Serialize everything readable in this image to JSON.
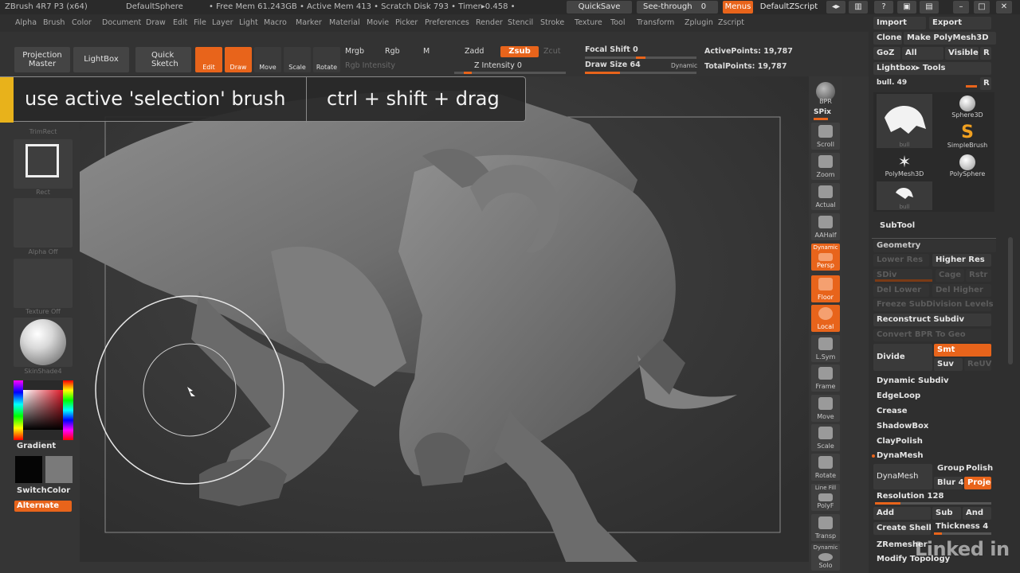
{
  "titlebar": {
    "title": "ZBrush 4R7 P3 (x64)",
    "document": "DefaultSphere",
    "status": "• Free Mem 61.243GB • Active Mem 413 • Scratch Disk 793 • Timer▸0.458 •",
    "quicksave": "QuickSave",
    "seethrough": "See-through",
    "seethrough_value": "0",
    "menus": "Menus",
    "script": "DefaultZScript"
  },
  "menubar": [
    "Alpha",
    "Brush",
    "Color",
    "Document",
    "Draw",
    "Edit",
    "File",
    "Layer",
    "Light",
    "Macro",
    "Marker",
    "Material",
    "Movie",
    "Picker",
    "Preferences",
    "Render",
    "Stencil",
    "Stroke",
    "Texture",
    "Tool",
    "Transform",
    "Zplugin",
    "Zscript"
  ],
  "topshelf": {
    "projection_master": "Projection Master",
    "lightbox": "LightBox",
    "quick_sketch": "Quick Sketch",
    "edit": "Edit",
    "draw": "Draw",
    "move": "Move",
    "scale": "Scale",
    "rotate": "Rotate",
    "mrgb": "Mrgb",
    "rgb": "Rgb",
    "m": "M",
    "rgb_intensity": "Rgb Intensity",
    "zadd": "Zadd",
    "zsub": "Zsub",
    "zcut": "Zcut",
    "z_intensity": "Z Intensity",
    "z_intensity_value": "0",
    "focal_shift": "Focal Shift",
    "focal_shift_value": "0",
    "draw_size": "Draw Size",
    "draw_size_value": "64",
    "dynamic": "Dynamic",
    "active_points": "ActivePoints: 19,787",
    "total_points": "TotalPoints: 19,787"
  },
  "overlay": {
    "instruction": "use active 'selection' brush",
    "shortcut": "ctrl + shift + drag"
  },
  "leftpanel": {
    "trimrect": "TrimRect",
    "rect": "Rect",
    "alpha_off": "Alpha Off",
    "texture_off": "Texture Off",
    "skinshade": "SkinShade4",
    "gradient": "Gradient",
    "switchcolor": "SwitchColor",
    "alternate": "Alternate"
  },
  "rightshelf": {
    "bpr": "BPR",
    "spix": "SPix",
    "spix_value": "3",
    "scroll": "Scroll",
    "zoom": "Zoom",
    "actual": "Actual",
    "aahalf": "AAHalf",
    "dynamic": "Dynamic",
    "persp": "Persp",
    "floor": "Floor",
    "local": "Local",
    "lsym": "L.Sym",
    "frame": "Frame",
    "move": "Move",
    "scale": "Scale",
    "rotate": "Rotate",
    "linefill": "Line Fill",
    "polyf": "PolyF",
    "transp": "Transp",
    "dynamic2": "Dynamic",
    "solo": "Solo"
  },
  "rightpanel": {
    "import": "Import",
    "export": "Export",
    "clone": "Clone",
    "make_polymesh": "Make PolyMesh3D",
    "goz": "GoZ",
    "all": "All",
    "visible": "Visible",
    "r": "R",
    "lightbox_tools": "Lightbox▸ Tools",
    "tool_name": "bull. 49",
    "tools": [
      {
        "name": "bull"
      },
      {
        "name": "Sphere3D"
      },
      {
        "name": "SimpleBrush"
      },
      {
        "name": "PolyMesh3D"
      },
      {
        "name": "PolySphere"
      },
      {
        "name": "bull"
      }
    ],
    "subtool": "SubTool",
    "geometry": "Geometry",
    "lower_res": "Lower Res",
    "higher_res": "Higher Res",
    "sdiv": "SDiv",
    "cage": "Cage",
    "rstr": "Rstr",
    "del_lower": "Del Lower",
    "del_higher": "Del Higher",
    "freeze": "Freeze SubDivision Levels",
    "reconstruct": "Reconstruct Subdiv",
    "convert_bpr": "Convert BPR To Geo",
    "divide": "Divide",
    "smt": "Smt",
    "suv": "Suv",
    "reuv": "ReUV",
    "dynamic_subdiv": "Dynamic Subdiv",
    "edgeloop": "EdgeLoop",
    "crease": "Crease",
    "shadowbox": "ShadowBox",
    "claypolish": "ClayPolish",
    "dynamesh_header": "DynaMesh",
    "dynamesh": "DynaMesh",
    "group": "Group",
    "polish": "Polish",
    "blur": "Blur",
    "blur_value": "4",
    "project": "Project",
    "resolution": "Resolution",
    "resolution_value": "128",
    "add": "Add",
    "sub": "Sub",
    "and": "And",
    "create_shell": "Create Shell",
    "thickness": "Thickness",
    "thickness_value": "4",
    "zremesher": "ZRemesher",
    "modify_topology": "Modify Topology"
  },
  "watermark": "Linked in",
  "colors": {
    "accent": "#e8641b",
    "highlight": "#e8b21b"
  }
}
